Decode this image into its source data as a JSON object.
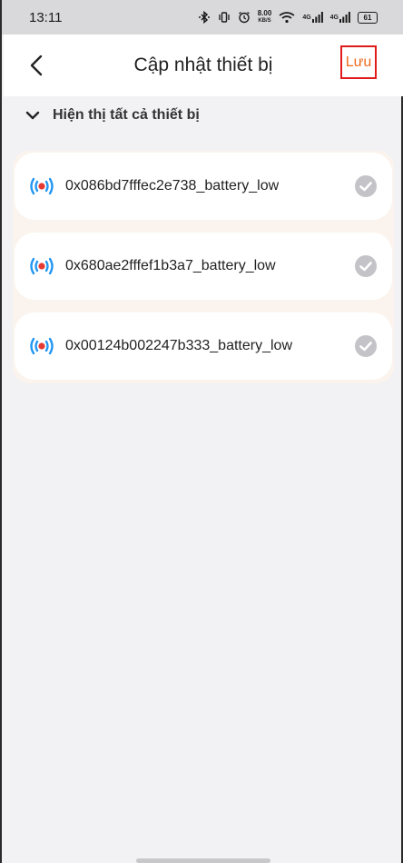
{
  "status_bar": {
    "time": "13:11",
    "speed_value": "8.00",
    "speed_unit": "KB/S",
    "net_1": "4G",
    "net_2": "4G",
    "battery": "61"
  },
  "header": {
    "title": "Cập nhật thiết bị",
    "save_label": "Lưu"
  },
  "section": {
    "label": "Hiện thị tất cả thiết bị"
  },
  "devices": [
    {
      "name": "0x086bd7fffec2e738_battery_low"
    },
    {
      "name": "0x680ae2fffef1b3a7_battery_low"
    },
    {
      "name": "0x00124b002247b333_battery_low"
    }
  ],
  "colors": {
    "accent": "#f06a1d",
    "highlight_border": "#e01b1b",
    "sensor_blue": "#2196f3",
    "sensor_red": "#e53935",
    "check_gray": "#c4c4c8"
  }
}
